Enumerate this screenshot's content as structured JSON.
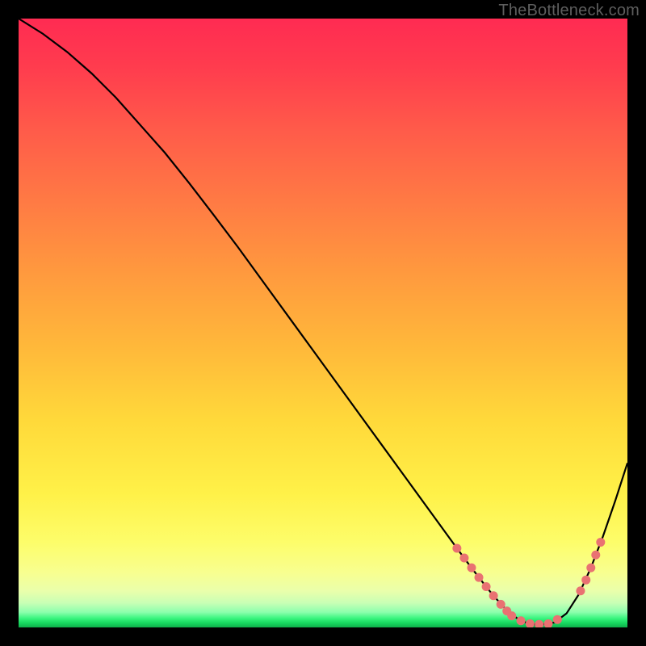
{
  "watermark": "TheBottleneck.com",
  "colors": {
    "frame": "#000000",
    "curve": "#000000",
    "marker": "#e97272",
    "gradient_top": "#ff2b52",
    "gradient_bottom": "#0fae4b"
  },
  "chart_data": {
    "type": "line",
    "title": "",
    "xlabel": "",
    "ylabel": "",
    "xlim": [
      0,
      100
    ],
    "ylim": [
      0,
      100
    ],
    "grid": false,
    "legend": false,
    "series": [
      {
        "name": "bottleneck-curve",
        "x": [
          0,
          4,
          8,
          12,
          16,
          20,
          24,
          28,
          32,
          36,
          40,
          44,
          48,
          52,
          56,
          60,
          64,
          68,
          72,
          74,
          76,
          78,
          80,
          82,
          84,
          86,
          88,
          90,
          92,
          94,
          96,
          98,
          100
        ],
        "y": [
          100,
          97.5,
          94.5,
          91,
          87,
          82.5,
          78,
          73,
          67.8,
          62.5,
          57,
          51.5,
          46,
          40.5,
          35,
          29.5,
          24,
          18.5,
          13,
          10.3,
          7.7,
          5.2,
          3.0,
          1.4,
          0.5,
          0.5,
          0.8,
          2.3,
          5.4,
          9.8,
          15.0,
          20.8,
          27.0
        ]
      }
    ],
    "markers": [
      {
        "name": "bottom-cluster-left",
        "color": "#e97272",
        "points": [
          {
            "x": 72.0,
            "y": 13.0
          },
          {
            "x": 73.2,
            "y": 11.4
          },
          {
            "x": 74.4,
            "y": 9.8
          },
          {
            "x": 75.6,
            "y": 8.2
          },
          {
            "x": 76.8,
            "y": 6.7
          },
          {
            "x": 78.0,
            "y": 5.2
          },
          {
            "x": 79.2,
            "y": 3.8
          },
          {
            "x": 80.2,
            "y": 2.7
          },
          {
            "x": 81.0,
            "y": 1.9
          },
          {
            "x": 82.5,
            "y": 1.1
          },
          {
            "x": 84.0,
            "y": 0.6
          },
          {
            "x": 85.5,
            "y": 0.5
          },
          {
            "x": 87.0,
            "y": 0.6
          },
          {
            "x": 88.5,
            "y": 1.3
          }
        ]
      },
      {
        "name": "bottom-cluster-right",
        "color": "#e97272",
        "points": [
          {
            "x": 92.3,
            "y": 6.0
          },
          {
            "x": 93.2,
            "y": 7.8
          },
          {
            "x": 94.0,
            "y": 9.8
          },
          {
            "x": 94.8,
            "y": 11.9
          },
          {
            "x": 95.6,
            "y": 14.0
          }
        ]
      }
    ]
  }
}
